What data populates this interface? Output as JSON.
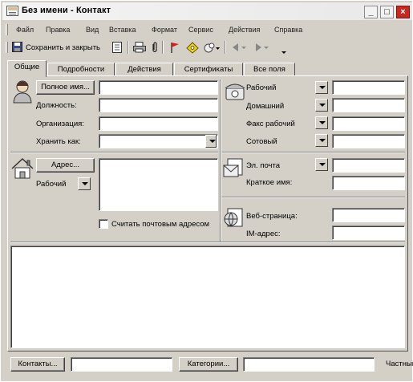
{
  "window": {
    "title": "Без имени - Контакт",
    "controls": [
      "_",
      "□",
      "×"
    ]
  },
  "menu": [
    {
      "label": "Файл"
    },
    {
      "label": "Правка"
    },
    {
      "label": "Вид"
    },
    {
      "label": "Вставка"
    },
    {
      "label": "Формат"
    },
    {
      "label": "Сервис"
    },
    {
      "label": "Действия"
    },
    {
      "label": "Справка"
    }
  ],
  "toolbar": {
    "save_close_label": "Сохранить и закрыть",
    "icons": [
      "save-icon",
      "print-icon",
      "attach-icon",
      "flag-icon",
      "categories-icon",
      "display-map-icon",
      "previous-item-icon",
      "next-item-icon",
      "toolbar-options-icon"
    ]
  },
  "tabs": [
    {
      "label": "Общие",
      "active": true
    },
    {
      "label": "Подробности"
    },
    {
      "label": "Действия"
    },
    {
      "label": "Сертификаты"
    },
    {
      "label": "Все поля"
    }
  ],
  "general": {
    "full_name_button": "Полное имя...",
    "job_title_label": "Должность:",
    "company_label": "Организация:",
    "file_as_label": "Хранить как:",
    "address_button": "Адрес...",
    "address_type": "Рабочий",
    "mailing_address_label": "Считать почтовым адресом",
    "phones": [
      {
        "label": "Рабочий"
      },
      {
        "label": "Домашний"
      },
      {
        "label": "Факс рабочий"
      },
      {
        "label": "Сотовый"
      }
    ],
    "email_label": "Эл. почта",
    "display_as_label": "Краткое имя:",
    "web_page_label": "Веб-страница:",
    "im_address_label": "IM-адрес:"
  },
  "footer": {
    "contacts_button": "Контакты...",
    "categories_button": "Категории...",
    "private_label": "Частный"
  },
  "colors": {
    "face": "#d4d0c8",
    "close_button": "#c8281e",
    "field": "#ffffff"
  }
}
